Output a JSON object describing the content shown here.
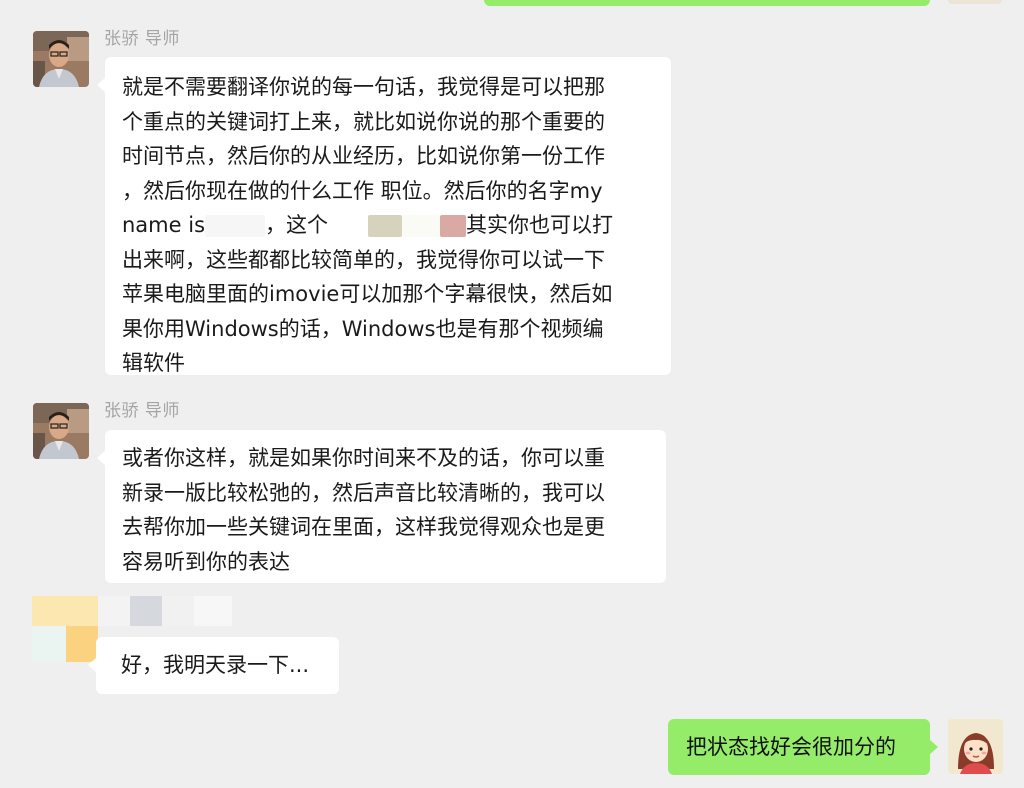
{
  "messages": [
    {
      "sender_name": "张骄 导师",
      "lines": [
        "就是不需要翻译你说的每一句话，我觉得是可以把那",
        "个重点的关键词打上来，就比如说你说的那个重要的",
        "时间节点，然后你的从业经历，比如说你第一份工作",
        "，然后你现在做的什么工作 职位。然后你的名字my",
        {
          "a": "name is",
          "b": "，这个",
          "c": "其实你也可以打"
        },
        "出来啊，这些都都比较简单的，我觉得你可以试一下",
        "苹果电脑里面的imovie可以加那个字幕很快，然后如",
        "果你用Windows的话，Windows也是有那个视频编",
        "辑软件"
      ]
    },
    {
      "sender_name": "张骄 导师",
      "lines": [
        "或者你这样，就是如果你时间来不及的话，你可以重",
        "新录一版比较松弛的，然后声音比较清晰的，我可以",
        "去帮你加一些关键词在里面，这样我觉得观众也是更",
        "容易听到你的表达"
      ]
    },
    {
      "text": "好，我明天录一下..."
    },
    {
      "text": "把状态找好会很加分的"
    }
  ],
  "colors": {
    "background": "#efefef",
    "bubble_white": "#ffffff",
    "bubble_green": "#95ec69",
    "name_gray": "#a4a4a4"
  },
  "icons": {
    "mentor_avatar": "man-with-glasses-avatar",
    "me_avatar": "cartoon-girl-avatar"
  }
}
